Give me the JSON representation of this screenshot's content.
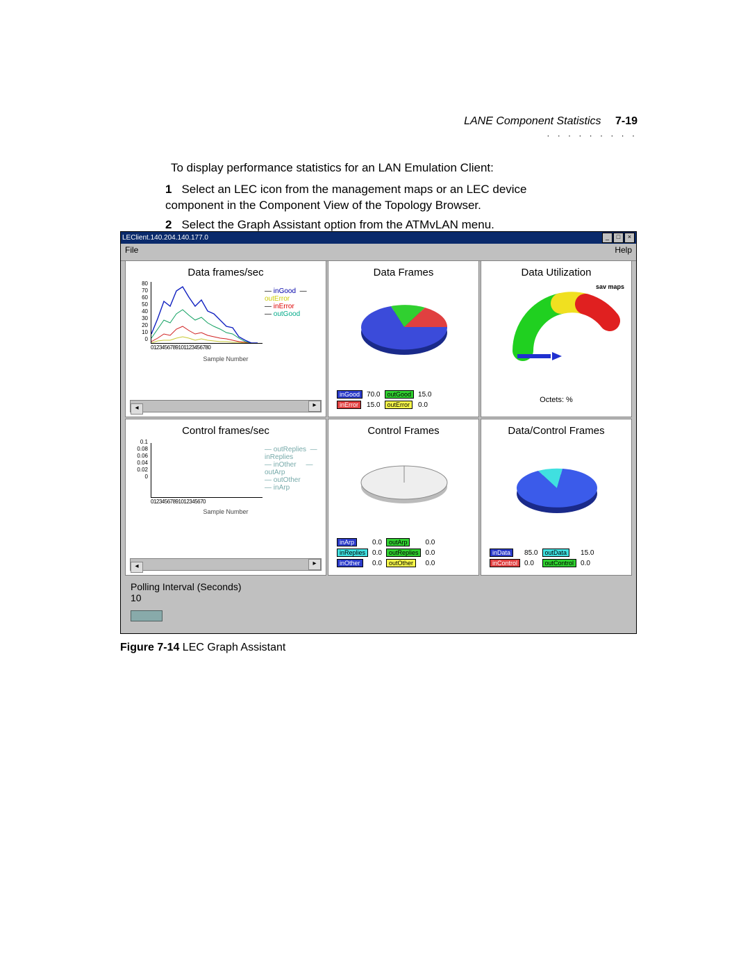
{
  "header": {
    "section": "LANE Component Statistics",
    "page": "7-19",
    "dots": "· · · · · · · · ·"
  },
  "text": {
    "intro": "To display performance statistics for an LAN Emulation Client:",
    "step1num": "1",
    "step1": "Select an LEC icon from the management maps or an LEC device component in the Component View of the Topology Browser.",
    "step2num": "2",
    "step2": "Select the Graph Assistant option from the ATMvLAN menu."
  },
  "caption": {
    "bold": "Figure 7-14",
    "rest": "   LEC Graph Assistant"
  },
  "window": {
    "title": "LEClient.140.204.140.177.0",
    "menu": {
      "file": "File",
      "help": "Help"
    },
    "buttons": {
      "min": "_",
      "max": "□",
      "close": "×"
    }
  },
  "panels": {
    "dataFramesSec": {
      "title": "Data frames/sec",
      "xlabel": "Sample Number",
      "xTicks": "0123456789101123456780",
      "legend": {
        "inGood": "inGood",
        "outError": "outError",
        "inError": "inError",
        "outGood": "outGood"
      }
    },
    "dataFrames": {
      "title": "Data Frames"
    },
    "dataUtil": {
      "title": "Data Utilization",
      "top": "sav maps",
      "bottom": "Octets:      %"
    },
    "controlFramesSec": {
      "title": "Control frames/sec",
      "xlabel": "Sample Number",
      "xTicks": "01234567891012345670",
      "legend": {
        "outReplies": "outReplies",
        "inReplies": "inReplies",
        "inOther": "inOther",
        "outArp": "outArp",
        "outOther": "outOther",
        "inArp": "inArp"
      }
    },
    "controlFrames": {
      "title": "Control Frames"
    },
    "dataControl": {
      "title": "Data/Control Frames"
    }
  },
  "legends": {
    "dataFrames": {
      "inGood": "inGood",
      "inGoodV": "70.0",
      "outGood": "outGood",
      "outGoodV": "15.0",
      "inError": "inError",
      "inErrorV": "15.0",
      "outError": "outError",
      "outErrorV": "0.0"
    },
    "controlFrames": {
      "inArp": "inArp",
      "inArpV": "0.0",
      "outArp": "outArp",
      "outArpV": "0.0",
      "inReplies": "inReplies",
      "inRepliesV": "0.0",
      "outReplies": "outReplies",
      "outRepliesV": "0.0",
      "inOther": "inOther",
      "inOtherV": "0.0",
      "outOther": "outOther",
      "outOtherV": "0.0"
    },
    "dataControl": {
      "inData": "inData",
      "inDataV": "85.0",
      "outData": "outData",
      "outDataV": "15.0",
      "inControl": "inControl",
      "inControlV": "0.0",
      "outControl": "outControl",
      "outControlV": "0.0"
    }
  },
  "footer": {
    "poll_label": "Polling Interval (Seconds)",
    "poll_value": "10"
  },
  "chart_data": [
    {
      "type": "line",
      "title": "Data frames/sec",
      "xlabel": "Sample Number",
      "ylabel": "",
      "ylim": [
        0,
        80
      ],
      "yticks": [
        0,
        10,
        20,
        30,
        40,
        50,
        60,
        70,
        80
      ],
      "x": [
        0,
        1,
        2,
        3,
        4,
        5,
        6,
        7,
        8,
        9,
        10,
        11,
        12,
        13,
        14,
        15,
        16,
        17,
        18
      ],
      "series": [
        {
          "name": "inGood",
          "color": "#1020c0",
          "values": [
            12,
            32,
            55,
            48,
            68,
            74,
            60,
            48,
            56,
            42,
            38,
            30,
            22,
            20,
            8,
            4,
            0,
            0,
            0
          ]
        },
        {
          "name": "outGood",
          "color": "#10a060",
          "values": [
            6,
            18,
            30,
            26,
            38,
            44,
            36,
            30,
            34,
            26,
            22,
            18,
            14,
            12,
            6,
            2,
            0,
            0,
            0
          ]
        },
        {
          "name": "inError",
          "color": "#d02020",
          "values": [
            2,
            6,
            12,
            10,
            18,
            22,
            16,
            12,
            14,
            10,
            8,
            6,
            5,
            4,
            2,
            1,
            0,
            0,
            0
          ]
        },
        {
          "name": "outError",
          "color": "#c8c830",
          "values": [
            0,
            2,
            4,
            4,
            6,
            8,
            6,
            4,
            5,
            4,
            3,
            2,
            2,
            1,
            1,
            0,
            0,
            0,
            0
          ]
        }
      ]
    },
    {
      "type": "pie",
      "title": "Data Frames",
      "series": [
        {
          "name": "inGood",
          "value": 70.0,
          "color": "#2b3bca"
        },
        {
          "name": "outGood",
          "value": 15.0,
          "color": "#30d030"
        },
        {
          "name": "inError",
          "value": 15.0,
          "color": "#e04040"
        },
        {
          "name": "outError",
          "value": 0.0,
          "color": "#f7f74a"
        }
      ]
    },
    {
      "type": "area",
      "title": "Data Utilization",
      "unit": "Octets %",
      "max_label": "sav maps",
      "value": 0,
      "scale": [
        0,
        100
      ]
    },
    {
      "type": "line",
      "title": "Control frames/sec",
      "xlabel": "Sample Number",
      "ylabel": "",
      "ylim": [
        0,
        0.1
      ],
      "yticks": [
        0,
        0.02,
        0.04,
        0.06,
        0.08,
        0.1
      ],
      "x": [
        0,
        1,
        2,
        3,
        4,
        5,
        6,
        7,
        8,
        9,
        10,
        11,
        12,
        13,
        14,
        15,
        16,
        17
      ],
      "series": [
        {
          "name": "outReplies",
          "color": "#50c8c8",
          "values": [
            0,
            0,
            0,
            0,
            0,
            0,
            0,
            0,
            0,
            0,
            0,
            0,
            0,
            0,
            0,
            0,
            0,
            0
          ]
        },
        {
          "name": "inReplies",
          "color": "#50c8c8",
          "values": [
            0,
            0,
            0,
            0,
            0,
            0,
            0,
            0,
            0,
            0,
            0,
            0,
            0,
            0,
            0,
            0,
            0,
            0
          ]
        },
        {
          "name": "inOther",
          "color": "#1020c0",
          "values": [
            0,
            0,
            0,
            0,
            0,
            0,
            0,
            0,
            0,
            0,
            0,
            0,
            0,
            0,
            0,
            0,
            0,
            0
          ]
        },
        {
          "name": "outArp",
          "color": "#50c8c8",
          "values": [
            0,
            0,
            0,
            0,
            0,
            0,
            0,
            0,
            0,
            0,
            0,
            0,
            0,
            0,
            0,
            0,
            0,
            0
          ]
        },
        {
          "name": "outOther",
          "color": "#808080",
          "values": [
            0,
            0,
            0,
            0,
            0,
            0,
            0,
            0,
            0,
            0,
            0,
            0,
            0,
            0,
            0,
            0,
            0,
            0
          ]
        },
        {
          "name": "inArp",
          "color": "#1020c0",
          "values": [
            0,
            0,
            0,
            0,
            0,
            0,
            0,
            0,
            0,
            0,
            0,
            0,
            0,
            0,
            0,
            0,
            0,
            0
          ]
        }
      ]
    },
    {
      "type": "pie",
      "title": "Control Frames",
      "series": [
        {
          "name": "inArp",
          "value": 0.0
        },
        {
          "name": "outArp",
          "value": 0.0
        },
        {
          "name": "inReplies",
          "value": 0.0
        },
        {
          "name": "outReplies",
          "value": 0.0
        },
        {
          "name": "inOther",
          "value": 0.0
        },
        {
          "name": "outOther",
          "value": 0.0
        }
      ]
    },
    {
      "type": "pie",
      "title": "Data/Control Frames",
      "series": [
        {
          "name": "inData",
          "value": 85.0,
          "color": "#2b3bca"
        },
        {
          "name": "outData",
          "value": 15.0,
          "color": "#40e0e0"
        },
        {
          "name": "inControl",
          "value": 0.0,
          "color": "#e04040"
        },
        {
          "name": "outControl",
          "value": 0.0,
          "color": "#30d030"
        }
      ]
    }
  ]
}
